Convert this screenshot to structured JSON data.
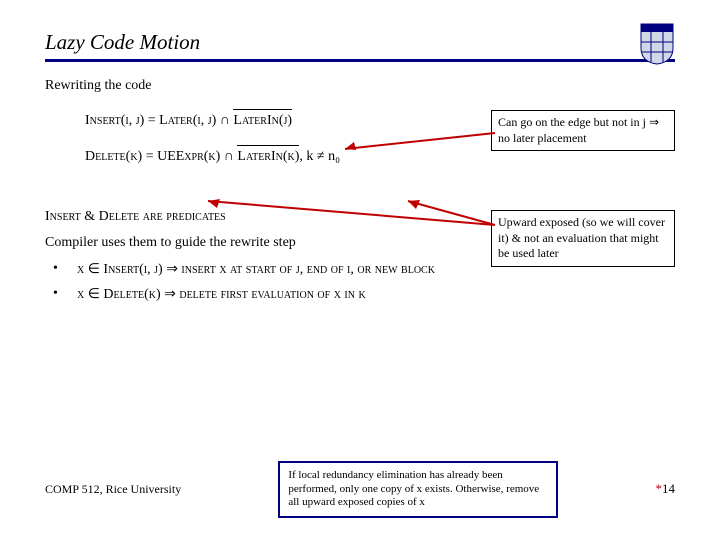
{
  "title": "Lazy Code Motion",
  "subtitle": "Rewriting the code",
  "formula1": {
    "lhs": "Insert(i, j) = Later(i, j) ∩ ",
    "overbar": "LaterIn(j)"
  },
  "formula2": {
    "lhs": "Delete(k) = UEExpr(k) ∩ ",
    "overbar": "LaterIn(k)",
    "tail": ", k ≠ n₀"
  },
  "callout1": "Can go on the edge but not in j ⇒ no later placement",
  "callout2": "Upward exposed (so we will cover it) & not an evaluation that might be used later",
  "pred_line": "Insert & Delete are predicates",
  "compiler_line": "Compiler uses them to guide the rewrite step",
  "bullets": [
    "x ∈ Insert(i, j) ⇒ insert x at start of j, end of i, or new block",
    "x ∈ Delete(k) ⇒ delete first evaluation of x in k"
  ],
  "footer_left": "COMP 512, Rice University",
  "footnote": "If local redundancy elimination has already been performed, only one copy of x exists. Otherwise, remove all upward exposed copies of x",
  "page": "14",
  "star": "*"
}
